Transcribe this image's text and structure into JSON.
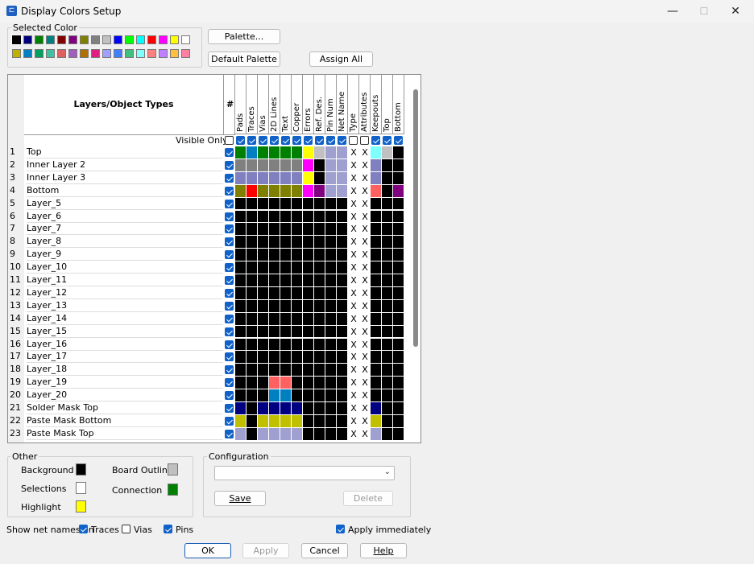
{
  "window": {
    "title": "Display Colors Setup",
    "minimize": "—",
    "maximize": "☐",
    "close": "✕"
  },
  "selected_color": {
    "label": "Selected Color",
    "row1": [
      "#000000",
      "#000080",
      "#008000",
      "#008080",
      "#800000",
      "#800080",
      "#808000",
      "#808080",
      "#c0c0c0",
      "#0000ff",
      "#00ff00",
      "#00ffff",
      "#ff0000",
      "#ff00ff",
      "#ffff00",
      "#ffffff"
    ],
    "row2": [
      "#c0b000",
      "#0080c0",
      "#00a060",
      "#40c0a0",
      "#e06060",
      "#a060c0",
      "#b07000",
      "#e02080",
      "#a0a0ff",
      "#4080ff",
      "#40c080",
      "#80ffff",
      "#ff8080",
      "#c080ff",
      "#ffc040",
      "#ff80a0"
    ]
  },
  "buttons": {
    "palette": "Palette...",
    "default_palette": "Default Palette",
    "assign_all": "Assign All"
  },
  "grid": {
    "header_title": "Layers/Object Types",
    "hash": "#",
    "visible_only": "Visible Only",
    "columns": [
      "Pads",
      "Traces",
      "Vias",
      "2D Lines",
      "Text",
      "Copper",
      "Errors",
      "Ref. Des.",
      "Pin Num",
      "Net Name",
      "Type",
      "Attributes",
      "Keepouts",
      "Top",
      "Bottom"
    ],
    "visible_only_checks": [
      true,
      true,
      true,
      true,
      true,
      true,
      true,
      true,
      true,
      true,
      false,
      false,
      true,
      true,
      true
    ],
    "rows": [
      {
        "n": "1",
        "name": "Top"
      },
      {
        "n": "2",
        "name": "Inner Layer 2"
      },
      {
        "n": "3",
        "name": "Inner Layer 3"
      },
      {
        "n": "4",
        "name": "Bottom"
      },
      {
        "n": "5",
        "name": "Layer_5"
      },
      {
        "n": "6",
        "name": "Layer_6"
      },
      {
        "n": "7",
        "name": "Layer_7"
      },
      {
        "n": "8",
        "name": "Layer_8"
      },
      {
        "n": "9",
        "name": "Layer_9"
      },
      {
        "n": "10",
        "name": "Layer_10"
      },
      {
        "n": "11",
        "name": "Layer_11"
      },
      {
        "n": "12",
        "name": "Layer_12"
      },
      {
        "n": "13",
        "name": "Layer_13"
      },
      {
        "n": "14",
        "name": "Layer_14"
      },
      {
        "n": "15",
        "name": "Layer_15"
      },
      {
        "n": "16",
        "name": "Layer_16"
      },
      {
        "n": "17",
        "name": "Layer_17"
      },
      {
        "n": "18",
        "name": "Layer_18"
      },
      {
        "n": "19",
        "name": "Layer_19"
      },
      {
        "n": "20",
        "name": "Layer_20"
      },
      {
        "n": "21",
        "name": "Solder Mask Top"
      },
      {
        "n": "22",
        "name": "Paste Mask Bottom"
      },
      {
        "n": "23",
        "name": "Paste Mask Top"
      }
    ],
    "x_mark": "X"
  },
  "other": {
    "label": "Other",
    "background": "Background",
    "background_color": "#000000",
    "selections": "Selections",
    "selections_color": "#ffffff",
    "highlight": "Highlight",
    "highlight_color": "#ffff00",
    "board_outline": "Board Outline",
    "board_outline_color": "#c0c0c0",
    "connection": "Connection",
    "connection_color": "#008000"
  },
  "configuration": {
    "label": "Configuration",
    "value": "",
    "save": "Save",
    "delete": "Delete"
  },
  "net_names": {
    "label": "Show net names on",
    "traces": "Traces",
    "traces_checked": true,
    "vias": "Vias",
    "vias_checked": false,
    "pins": "Pins",
    "pins_checked": true
  },
  "apply_immediately": {
    "label": "Apply immediately",
    "checked": true
  },
  "footer": {
    "ok": "OK",
    "apply": "Apply",
    "cancel": "Cancel",
    "help": "Help"
  }
}
